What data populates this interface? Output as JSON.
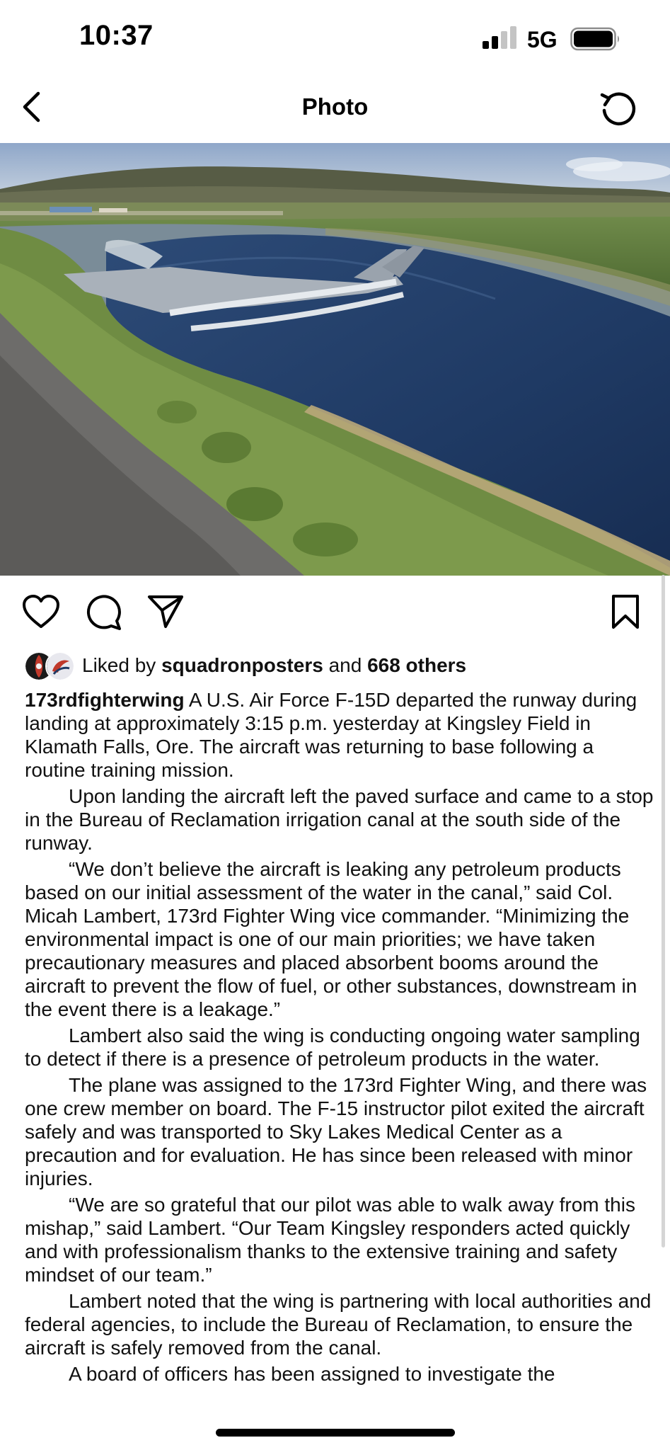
{
  "status_bar": {
    "time": "10:37",
    "network": "5G",
    "icons": [
      "signal-icon",
      "battery-icon"
    ]
  },
  "header": {
    "title": "Photo",
    "back_icon": "chevron-left-icon",
    "refresh_icon": "refresh-icon"
  },
  "post": {
    "image_subject": "F-15D aircraft resting in an irrigation canal beside a runway",
    "actions": [
      "heart-icon",
      "comment-icon",
      "share-icon",
      "bookmark-icon"
    ],
    "likes": {
      "prefix": "Liked by",
      "user": "squadronposters",
      "joiner": "and",
      "others": "668 others"
    },
    "caption": {
      "username": "173rdfighterwing",
      "paragraphs": [
        "A U.S. Air Force F-15D departed the runway during landing at approximately 3:15 p.m. yesterday at Kingsley Field in Klamath Falls, Ore.  The aircraft was returning to base following a routine training mission.",
        "Upon landing the aircraft left the paved surface and came to a stop in the Bureau of Reclamation irrigation canal at the south side of the runway.",
        "“We don’t believe the aircraft is leaking any petroleum products based on our initial assessment of the water in the canal,” said Col. Micah Lambert, 173rd Fighter Wing vice commander. “Minimizing the environmental impact is one of our main priorities; we have taken precautionary measures and placed absorbent booms around the aircraft to prevent the flow of fuel, or other substances, downstream in the event there is a leakage.”",
        "Lambert also said the wing is conducting ongoing water sampling to detect if there is a presence of petroleum products in the water.",
        "The plane was assigned to the 173rd Fighter Wing, and there was one crew member on board.  The F-15 instructor pilot exited the aircraft safely and was transported to Sky Lakes Medical Center as a precaution and for evaluation.  He has since been released with minor injuries.",
        "“We are so grateful that our pilot was able to walk away from this mishap,” said Lambert. “Our Team Kingsley responders acted quickly and with professionalism thanks to the extensive training and safety mindset of our team.”",
        "Lambert noted that the wing is partnering with local authorities and federal agencies, to include the Bureau of Reclamation, to ensure the aircraft is safely removed from the canal.",
        "A board of officers has been assigned to investigate the"
      ]
    }
  }
}
